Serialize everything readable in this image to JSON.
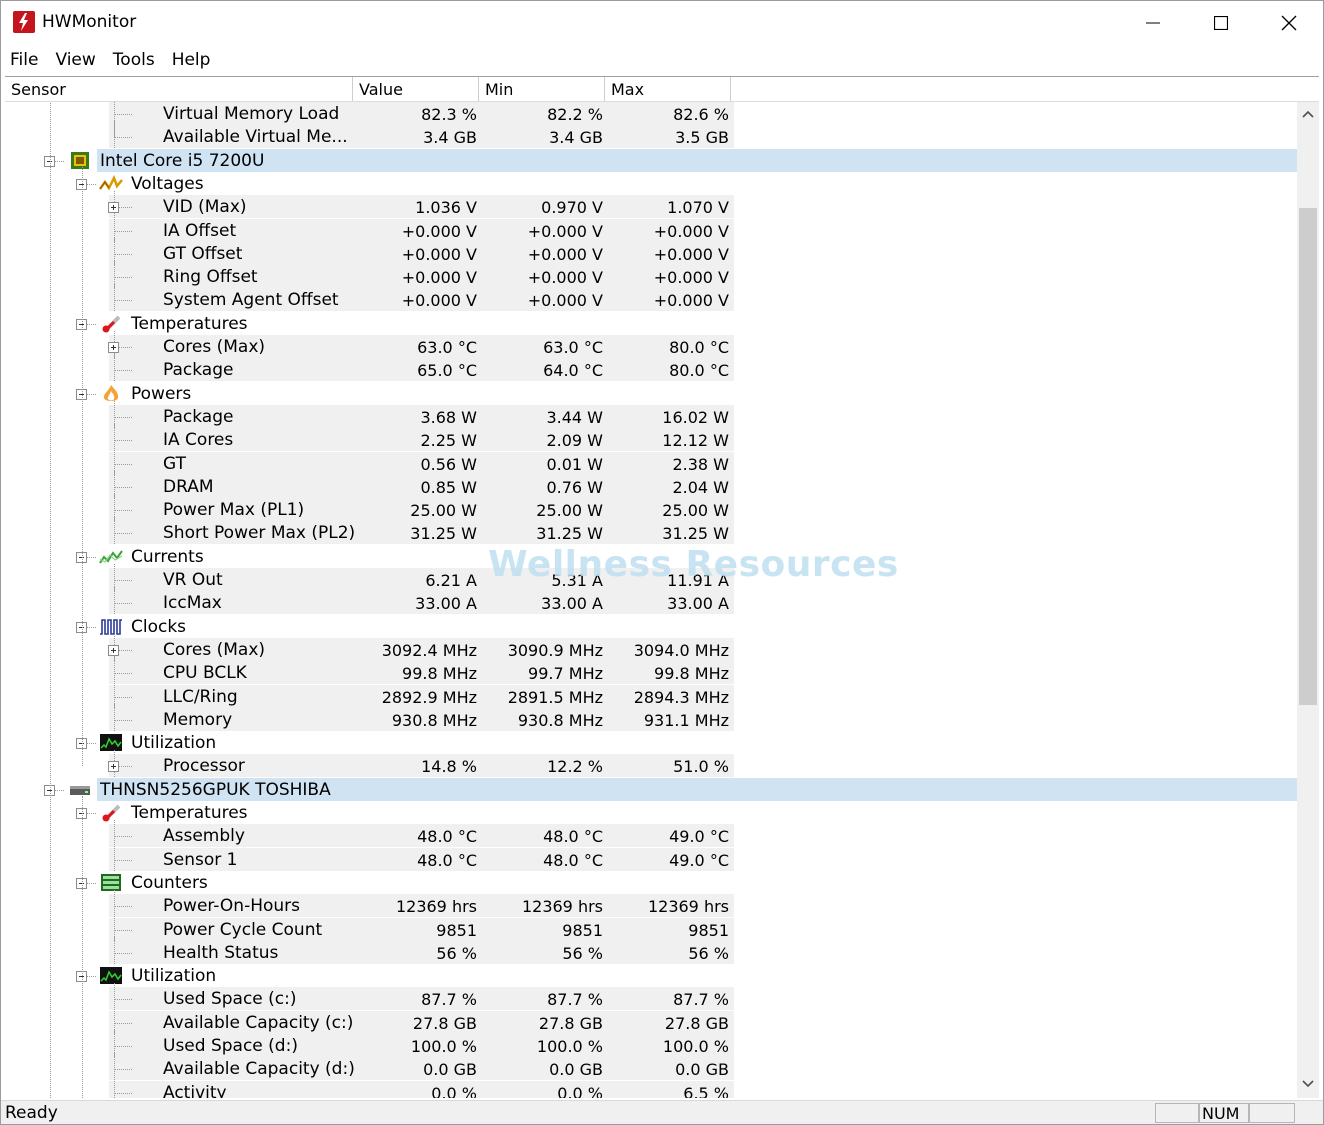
{
  "window": {
    "title": "HWMonitor"
  },
  "menu": [
    "File",
    "View",
    "Tools",
    "Help"
  ],
  "columns": [
    "Sensor",
    "Value",
    "Min",
    "Max"
  ],
  "rows": [
    {
      "label": "Virtual Memory Load",
      "value": "82.3 %",
      "min": "82.2 %",
      "max": "82.6 %"
    },
    {
      "label": "Available Virtual Me...",
      "value": "3.4 GB",
      "min": "3.4 GB",
      "max": "3.5 GB"
    },
    {
      "label": "Intel Core i5 7200U",
      "value": "",
      "min": "",
      "max": ""
    },
    {
      "label": "Voltages",
      "value": "",
      "min": "",
      "max": ""
    },
    {
      "label": "VID (Max)",
      "value": "1.036 V",
      "min": "0.970 V",
      "max": "1.070 V"
    },
    {
      "label": "IA Offset",
      "value": "+0.000 V",
      "min": "+0.000 V",
      "max": "+0.000 V"
    },
    {
      "label": "GT Offset",
      "value": "+0.000 V",
      "min": "+0.000 V",
      "max": "+0.000 V"
    },
    {
      "label": "Ring Offset",
      "value": "+0.000 V",
      "min": "+0.000 V",
      "max": "+0.000 V"
    },
    {
      "label": "System Agent Offset",
      "value": "+0.000 V",
      "min": "+0.000 V",
      "max": "+0.000 V"
    },
    {
      "label": "Temperatures",
      "value": "",
      "min": "",
      "max": ""
    },
    {
      "label": "Cores (Max)",
      "value": "63.0 °C",
      "min": "63.0 °C",
      "max": "80.0 °C"
    },
    {
      "label": "Package",
      "value": "65.0 °C",
      "min": "64.0 °C",
      "max": "80.0 °C"
    },
    {
      "label": "Powers",
      "value": "",
      "min": "",
      "max": ""
    },
    {
      "label": "Package",
      "value": "3.68 W",
      "min": "3.44 W",
      "max": "16.02 W"
    },
    {
      "label": "IA Cores",
      "value": "2.25 W",
      "min": "2.09 W",
      "max": "12.12 W"
    },
    {
      "label": "GT",
      "value": "0.56 W",
      "min": "0.01 W",
      "max": "2.38 W"
    },
    {
      "label": "DRAM",
      "value": "0.85 W",
      "min": "0.76 W",
      "max": "2.04 W"
    },
    {
      "label": "Power Max (PL1)",
      "value": "25.00 W",
      "min": "25.00 W",
      "max": "25.00 W"
    },
    {
      "label": "Short Power Max (PL2)",
      "value": "31.25 W",
      "min": "31.25 W",
      "max": "31.25 W"
    },
    {
      "label": "Currents",
      "value": "",
      "min": "",
      "max": ""
    },
    {
      "label": "VR Out",
      "value": "6.21 A",
      "min": "5.31 A",
      "max": "11.91 A"
    },
    {
      "label": "IccMax",
      "value": "33.00 A",
      "min": "33.00 A",
      "max": "33.00 A"
    },
    {
      "label": "Clocks",
      "value": "",
      "min": "",
      "max": ""
    },
    {
      "label": "Cores (Max)",
      "value": "3092.4 MHz",
      "min": "3090.9 MHz",
      "max": "3094.0 MHz"
    },
    {
      "label": "CPU BCLK",
      "value": "99.8 MHz",
      "min": "99.7 MHz",
      "max": "99.8 MHz"
    },
    {
      "label": "LLC/Ring",
      "value": "2892.9 MHz",
      "min": "2891.5 MHz",
      "max": "2894.3 MHz"
    },
    {
      "label": "Memory",
      "value": "930.8 MHz",
      "min": "930.8 MHz",
      "max": "931.1 MHz"
    },
    {
      "label": "Utilization",
      "value": "",
      "min": "",
      "max": ""
    },
    {
      "label": "Processor",
      "value": "14.8 %",
      "min": "12.2 %",
      "max": "51.0 %"
    },
    {
      "label": "THNSN5256GPUK TOSHIBA",
      "value": "",
      "min": "",
      "max": ""
    },
    {
      "label": "Temperatures",
      "value": "",
      "min": "",
      "max": ""
    },
    {
      "label": "Assembly",
      "value": "48.0 °C",
      "min": "48.0 °C",
      "max": "49.0 °C"
    },
    {
      "label": "Sensor 1",
      "value": "48.0 °C",
      "min": "48.0 °C",
      "max": "49.0 °C"
    },
    {
      "label": "Counters",
      "value": "",
      "min": "",
      "max": ""
    },
    {
      "label": "Power-On-Hours",
      "value": "12369 hrs",
      "min": "12369 hrs",
      "max": "12369 hrs"
    },
    {
      "label": "Power Cycle Count",
      "value": "9851",
      "min": "9851",
      "max": "9851"
    },
    {
      "label": "Health Status",
      "value": "56 %",
      "min": "56 %",
      "max": "56 %"
    },
    {
      "label": "Utilization",
      "value": "",
      "min": "",
      "max": ""
    },
    {
      "label": "Used Space (c:)",
      "value": "87.7 %",
      "min": "87.7 %",
      "max": "87.7 %"
    },
    {
      "label": "Available Capacity (c:)",
      "value": "27.8 GB",
      "min": "27.8 GB",
      "max": "27.8 GB"
    },
    {
      "label": "Used Space (d:)",
      "value": "100.0 %",
      "min": "100.0 %",
      "max": "100.0 %"
    },
    {
      "label": "Available Capacity (d:)",
      "value": "0.0 GB",
      "min": "0.0 GB",
      "max": "0.0 GB"
    },
    {
      "label": "Activity",
      "value": "0.0 %",
      "min": "0.0 %",
      "max": "6.5 %"
    }
  ],
  "status": {
    "text": "Ready",
    "num": "NUM"
  },
  "watermark": "Wellness Resources",
  "colors": {
    "selection": "#cfe3f3",
    "app_icon": "#c4151c",
    "stripe": "#f0f0f0"
  }
}
